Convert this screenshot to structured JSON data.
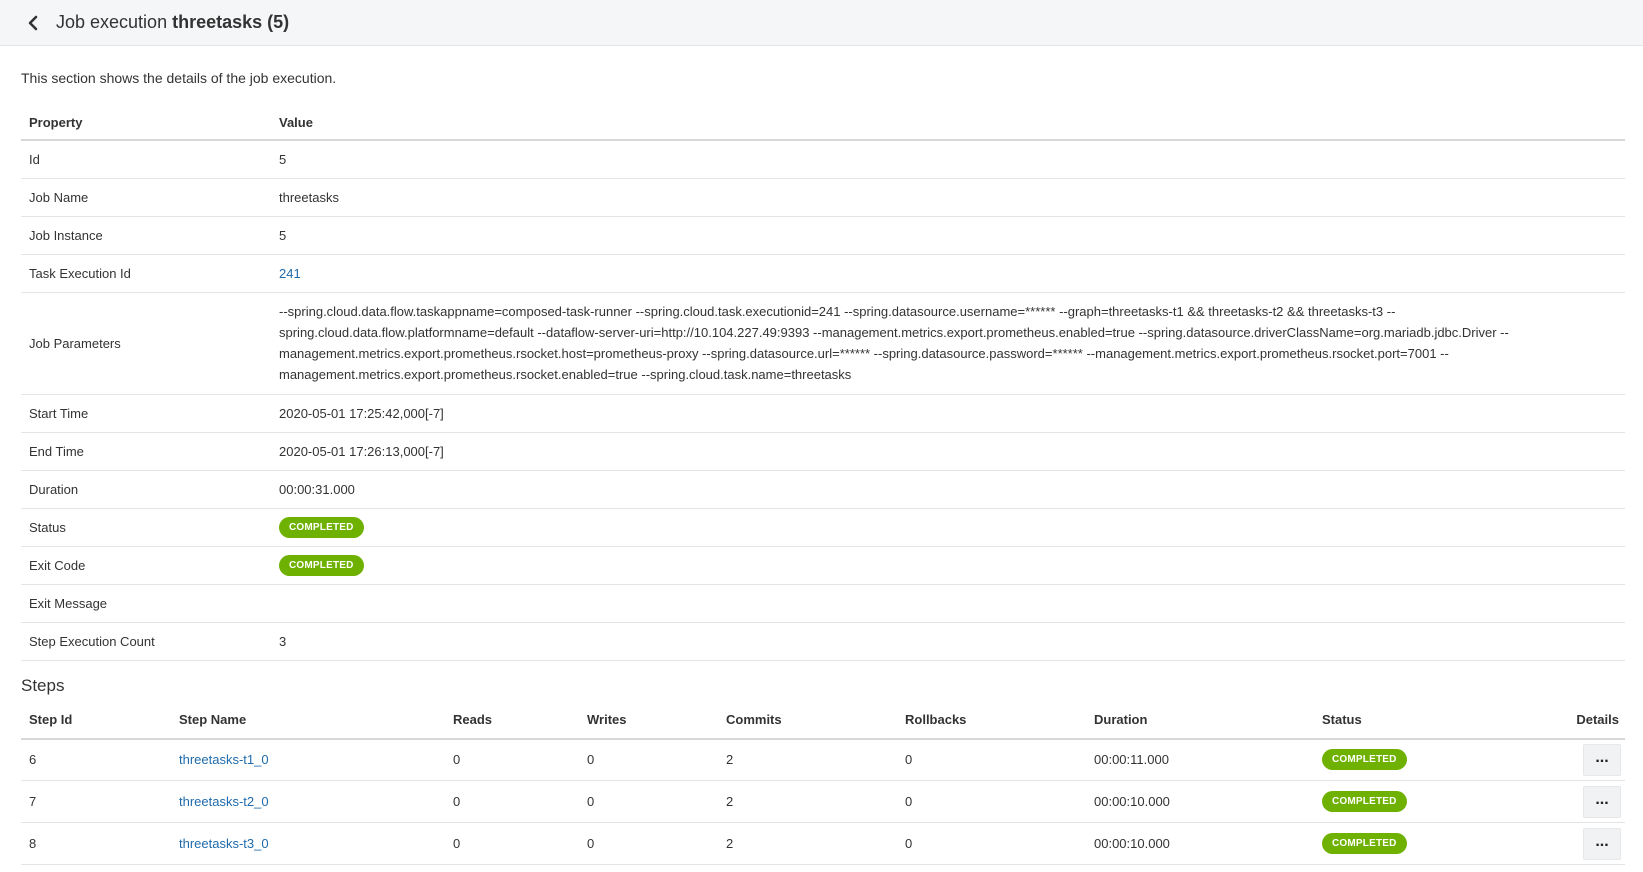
{
  "header": {
    "title_prefix": "Job execution",
    "job_name": "threetasks",
    "count": "(5)"
  },
  "intro": "This section shows the details of the job execution.",
  "properties": {
    "col_property": "Property",
    "col_value": "Value",
    "id": {
      "label": "Id",
      "value": "5"
    },
    "job_name": {
      "label": "Job Name",
      "value": "threetasks"
    },
    "job_instance": {
      "label": "Job Instance",
      "value": "5"
    },
    "task_execution_id": {
      "label": "Task Execution Id",
      "value": "241"
    },
    "job_parameters": {
      "label": "Job Parameters",
      "value": "--spring.cloud.data.flow.taskappname=composed-task-runner --spring.cloud.task.executionid=241 --spring.datasource.username=****** --graph=threetasks-t1 && threetasks-t2 && threetasks-t3 --spring.cloud.data.flow.platformname=default --dataflow-server-uri=http://10.104.227.49:9393 --management.metrics.export.prometheus.enabled=true --spring.datasource.driverClassName=org.mariadb.jdbc.Driver --management.metrics.export.prometheus.rsocket.host=prometheus-proxy --spring.datasource.url=****** --spring.datasource.password=****** --management.metrics.export.prometheus.rsocket.port=7001 --management.metrics.export.prometheus.rsocket.enabled=true --spring.cloud.task.name=threetasks"
    },
    "start_time": {
      "label": "Start Time",
      "value": "2020-05-01 17:25:42,000[-7]"
    },
    "end_time": {
      "label": "End Time",
      "value": "2020-05-01 17:26:13,000[-7]"
    },
    "duration": {
      "label": "Duration",
      "value": "00:00:31.000"
    },
    "status": {
      "label": "Status",
      "value": "COMPLETED"
    },
    "exit_code": {
      "label": "Exit Code",
      "value": "COMPLETED"
    },
    "exit_message": {
      "label": "Exit Message",
      "value": ""
    },
    "step_execution_count": {
      "label": "Step Execution Count",
      "value": "3"
    }
  },
  "steps": {
    "title": "Steps",
    "columns": [
      "Step Id",
      "Step Name",
      "Reads",
      "Writes",
      "Commits",
      "Rollbacks",
      "Duration",
      "Status",
      "Details"
    ],
    "details_label": "...",
    "rows": [
      {
        "id": "6",
        "name": "threetasks-t1_0",
        "reads": "0",
        "writes": "0",
        "commits": "2",
        "rollbacks": "0",
        "duration": "00:00:11.000",
        "status": "COMPLETED"
      },
      {
        "id": "7",
        "name": "threetasks-t2_0",
        "reads": "0",
        "writes": "0",
        "commits": "2",
        "rollbacks": "0",
        "duration": "00:00:10.000",
        "status": "COMPLETED"
      },
      {
        "id": "8",
        "name": "threetasks-t3_0",
        "reads": "0",
        "writes": "0",
        "commits": "2",
        "rollbacks": "0",
        "duration": "00:00:10.000",
        "status": "COMPLETED"
      }
    ]
  },
  "colors": {
    "link": "#1f6bac",
    "status_completed": "#6eb100",
    "header_bg": "#f5f6f7"
  },
  "icons": {
    "back": "chevron-left-icon"
  }
}
